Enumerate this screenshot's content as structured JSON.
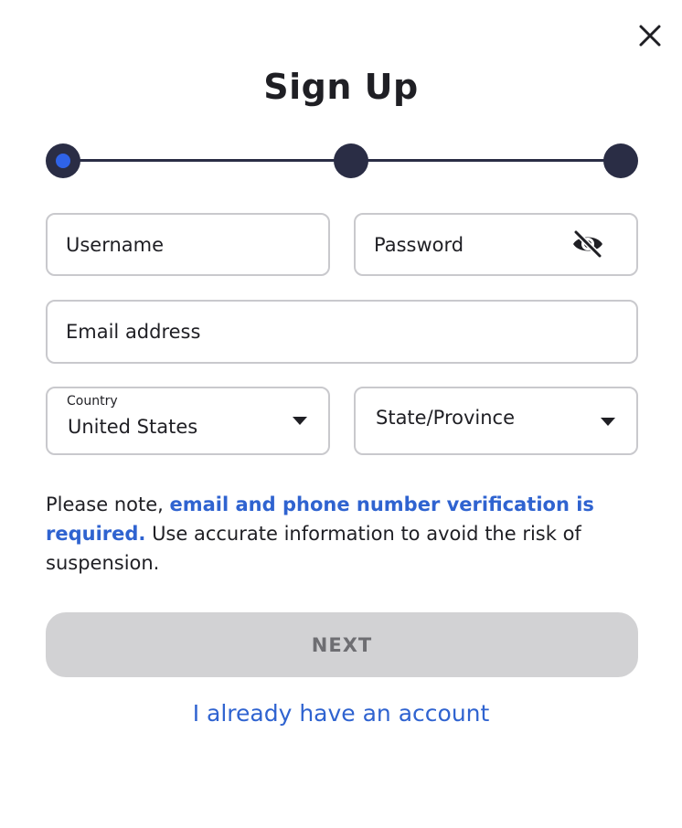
{
  "dialog": {
    "title": "Sign Up"
  },
  "stepper": {
    "current_step": 1,
    "total_steps": 3
  },
  "form": {
    "username": {
      "placeholder": "Username",
      "value": ""
    },
    "password": {
      "placeholder": "Password",
      "value": "",
      "toggle_icon": "eye-slash-icon"
    },
    "email": {
      "placeholder": "Email address",
      "value": ""
    },
    "country": {
      "label": "Country",
      "value": "United States"
    },
    "state": {
      "placeholder": "State/Province",
      "value": ""
    }
  },
  "note": {
    "prefix": "Please note, ",
    "highlight": "email and phone number verification is required.",
    "suffix": " Use accurate information to avoid the risk of suspension."
  },
  "actions": {
    "next_label": "NEXT",
    "login_link": "I already have an account"
  },
  "colors": {
    "accent": "#2f63d0",
    "step_dot": "#2a2d45",
    "button_disabled": "#d2d2d4"
  }
}
